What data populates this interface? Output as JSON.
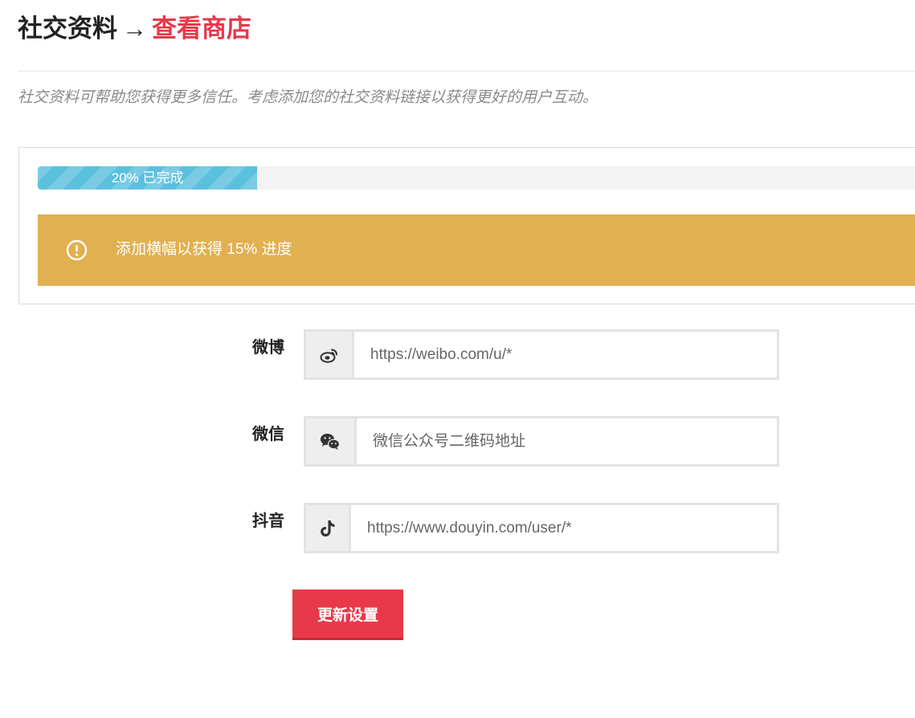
{
  "header": {
    "title": "社交资料",
    "arrow": "→",
    "store_link": "查看商店"
  },
  "intro_text": "社交资料可帮助您获得更多信任。考虑添加您的社交资料链接以获得更好的用户互动。",
  "progress": {
    "percent": 20,
    "label": "20% 已完成"
  },
  "notice": {
    "icon": "info-circle-icon",
    "text": "添加横幅以获得 15% 进度"
  },
  "fields": [
    {
      "label": "微博",
      "icon": "weibo-icon",
      "placeholder": "https://weibo.com/u/*",
      "value": ""
    },
    {
      "label": "微信",
      "icon": "wechat-icon",
      "placeholder": "微信公众号二维码地址",
      "value": ""
    },
    {
      "label": "抖音",
      "icon": "tiktok-icon",
      "placeholder": "https://www.douyin.com/user/*",
      "value": ""
    }
  ],
  "submit_label": "更新设置",
  "colors": {
    "accent": "#e8394a",
    "progress": "#5bc0de",
    "notice": "#e1b050"
  }
}
